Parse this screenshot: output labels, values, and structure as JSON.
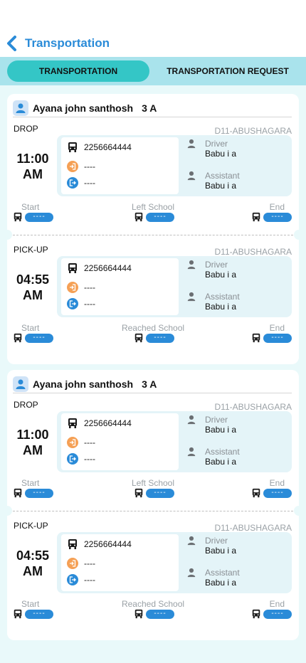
{
  "header": {
    "title": "Transportation"
  },
  "tabs": [
    {
      "label": "TRANSPORTATION",
      "active": true
    },
    {
      "label": "TRANSPORTATION  REQUEST",
      "active": false
    }
  ],
  "colors": {
    "accent": "#2a8bd8",
    "tab_active": "#34c6c6",
    "tab_bar": "#a9e3ec",
    "background": "#e9f9fa"
  },
  "cards": [
    {
      "student": {
        "name": "Ayana john santhosh",
        "class": "3 A"
      },
      "sections": [
        {
          "type": "DROP",
          "route": "D11-ABUSHAGARA",
          "time_hm": "11:00",
          "time_ampm": "AM",
          "bus_number": "2256664444",
          "line1": "----",
          "line2": "----",
          "driver_label": "Driver",
          "driver_name": "Babu i a",
          "assistant_label": "Assistant",
          "assistant_name": "Babu i a",
          "stages": [
            {
              "label": "Start",
              "value": "----"
            },
            {
              "label": "Left School",
              "value": "----"
            },
            {
              "label": "End",
              "value": "----"
            }
          ]
        },
        {
          "type": "PICK-UP",
          "route": "D11-ABUSHAGARA",
          "time_hm": "04:55",
          "time_ampm": "AM",
          "bus_number": "2256664444",
          "line1": "----",
          "line2": "----",
          "driver_label": "Driver",
          "driver_name": "Babu i a",
          "assistant_label": "Assistant",
          "assistant_name": "Babu i a",
          "stages": [
            {
              "label": "Start",
              "value": "----"
            },
            {
              "label": "Reached School",
              "value": "----"
            },
            {
              "label": "End",
              "value": "----"
            }
          ]
        }
      ]
    },
    {
      "student": {
        "name": "Ayana john santhosh",
        "class": "3 A"
      },
      "sections": [
        {
          "type": "DROP",
          "route": "D11-ABUSHAGARA",
          "time_hm": "11:00",
          "time_ampm": "AM",
          "bus_number": "2256664444",
          "line1": "----",
          "line2": "----",
          "driver_label": "Driver",
          "driver_name": "Babu i a",
          "assistant_label": "Assistant",
          "assistant_name": "Babu i a",
          "stages": [
            {
              "label": "Start",
              "value": "----"
            },
            {
              "label": "Left School",
              "value": "----"
            },
            {
              "label": "End",
              "value": "----"
            }
          ]
        },
        {
          "type": "PICK-UP",
          "route": "D11-ABUSHAGARA",
          "time_hm": "04:55",
          "time_ampm": "AM",
          "bus_number": "2256664444",
          "line1": "----",
          "line2": "----",
          "driver_label": "Driver",
          "driver_name": "Babu i a",
          "assistant_label": "Assistant",
          "assistant_name": "Babu i a",
          "stages": [
            {
              "label": "Start",
              "value": "----"
            },
            {
              "label": "Reached School",
              "value": "----"
            },
            {
              "label": "End",
              "value": "----"
            }
          ]
        }
      ]
    }
  ]
}
